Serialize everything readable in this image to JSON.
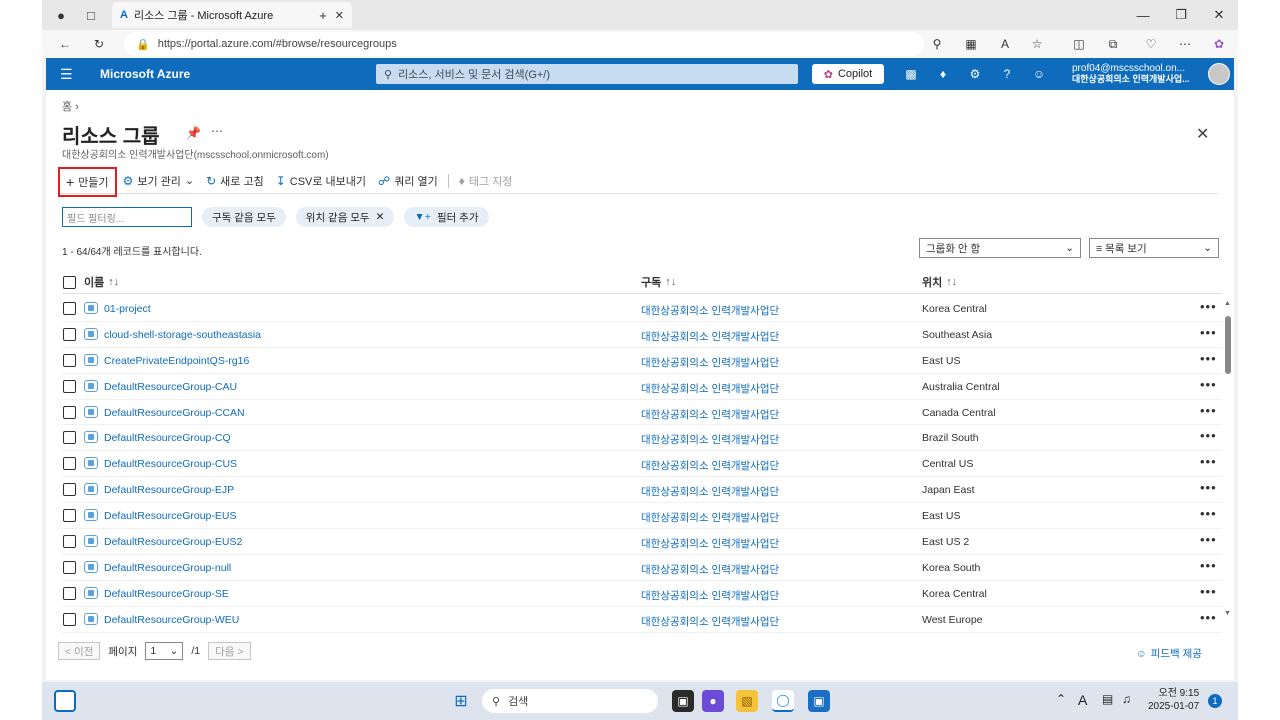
{
  "browser": {
    "tab_title": "리소스 그룹 - Microsoft Azure",
    "url": "https://portal.azure.com/#browse/resourcegroups"
  },
  "azure_bar": {
    "brand": "Microsoft Azure",
    "search_placeholder": "리소스, 서비스 및 문서 검색(G+/)",
    "copilot_label": "Copilot",
    "account_email": "prof04@mscsschool.on...",
    "account_org": "대한상공회의소 인력개발사업..."
  },
  "page": {
    "breadcrumb": "홈",
    "title": "리소스 그룹",
    "subtitle": "대한상공회의소 인력개발사업단(mscsschool.onmicrosoft.com)"
  },
  "toolbar": {
    "create": "만들기",
    "manage_view": "보기 관리",
    "refresh": "새로 고침",
    "export_csv": "CSV로 내보내기",
    "open_query": "쿼리 열기",
    "assign_tags": "태그 지정"
  },
  "filters": {
    "filter_placeholder": "필드 필터링...",
    "subscription_pill": "구독 같음 모두",
    "location_pill": "위치 같음 모두",
    "add_filter": "필터 추가"
  },
  "record_count": "1 - 64/64개 레코드를 표시합니다.",
  "grouping_dropdown": "그룹화 안 함",
  "view_dropdown": "목록 보기",
  "columns": {
    "name": "이름",
    "subscription": "구독",
    "location": "위치"
  },
  "rows": [
    {
      "name": "01-project",
      "subscription": "대한상공회의소 인력개발사업단",
      "location": "Korea Central"
    },
    {
      "name": "cloud-shell-storage-southeastasia",
      "subscription": "대한상공회의소 인력개발사업단",
      "location": "Southeast Asia"
    },
    {
      "name": "CreatePrivateEndpointQS-rg16",
      "subscription": "대한상공회의소 인력개발사업단",
      "location": "East US"
    },
    {
      "name": "DefaultResourceGroup-CAU",
      "subscription": "대한상공회의소 인력개발사업단",
      "location": "Australia Central"
    },
    {
      "name": "DefaultResourceGroup-CCAN",
      "subscription": "대한상공회의소 인력개발사업단",
      "location": "Canada Central"
    },
    {
      "name": "DefaultResourceGroup-CQ",
      "subscription": "대한상공회의소 인력개발사업단",
      "location": "Brazil South"
    },
    {
      "name": "DefaultResourceGroup-CUS",
      "subscription": "대한상공회의소 인력개발사업단",
      "location": "Central US"
    },
    {
      "name": "DefaultResourceGroup-EJP",
      "subscription": "대한상공회의소 인력개발사업단",
      "location": "Japan East"
    },
    {
      "name": "DefaultResourceGroup-EUS",
      "subscription": "대한상공회의소 인력개발사업단",
      "location": "East US"
    },
    {
      "name": "DefaultResourceGroup-EUS2",
      "subscription": "대한상공회의소 인력개발사업단",
      "location": "East US 2"
    },
    {
      "name": "DefaultResourceGroup-null",
      "subscription": "대한상공회의소 인력개발사업단",
      "location": "Korea South"
    },
    {
      "name": "DefaultResourceGroup-SE",
      "subscription": "대한상공회의소 인력개발사업단",
      "location": "Korea Central"
    },
    {
      "name": "DefaultResourceGroup-WEU",
      "subscription": "대한상공회의소 인력개발사업단",
      "location": "West Europe"
    }
  ],
  "pager": {
    "prev": "< 이전",
    "page_label": "페이지",
    "page_value": "1",
    "page_total": "/1",
    "next": "다음 >"
  },
  "feedback": "피드백 제공",
  "taskbar": {
    "search": "검색",
    "time": "오전 9:15",
    "date": "2025-01-07",
    "notifications": "1",
    "ime": "A"
  },
  "colors": {
    "azure_blue": "#0f6cbd",
    "highlight_red": "#e02020"
  }
}
